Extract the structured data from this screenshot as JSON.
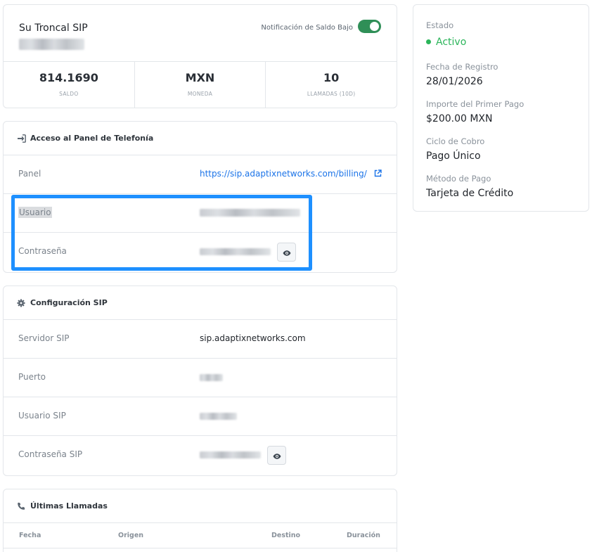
{
  "summary": {
    "title": "Su Troncal SIP",
    "toggle_label": "Notificación de Saldo Bajo",
    "toggle_on": true,
    "stats": [
      {
        "value": "814.1690",
        "label": "SALDO"
      },
      {
        "value": "MXN",
        "label": "MONEDA"
      },
      {
        "value": "10",
        "label": "LLAMADAS (10D)"
      }
    ]
  },
  "panel_access": {
    "title": "Acceso al Panel de Telefonía",
    "rows": {
      "panel_label": "Panel",
      "panel_link": "https://sip.adaptixnetworks.com/billing/",
      "user_label": "Usuario",
      "password_label": "Contraseña"
    }
  },
  "sip_config": {
    "title": "Configuración SIP",
    "server_label": "Servidor SIP",
    "server_value": "sip.adaptixnetworks.com",
    "port_label": "Puerto",
    "user_label": "Usuario SIP",
    "password_label": "Contraseña SIP"
  },
  "recent_calls": {
    "title": "Últimas Llamadas",
    "columns": [
      "Fecha",
      "Origen",
      "Destino",
      "Duración"
    ]
  },
  "account": {
    "status_label": "Estado",
    "status_value": "Activo",
    "registration_label": "Fecha de Registro",
    "registration_value": "28/01/2026",
    "first_payment_label": "Importe del Primer Pago",
    "first_payment_value": "$200.00 MXN",
    "billing_cycle_label": "Ciclo de Cobro",
    "billing_cycle_value": "Pago Único",
    "payment_method_label": "Método de Pago",
    "payment_method_value": "Tarjeta de Crédito"
  },
  "colors": {
    "accent": "#1a73e8",
    "toggle_on": "#2f8f57",
    "status_active": "#2bb55a",
    "highlight": "#1e90ff"
  }
}
